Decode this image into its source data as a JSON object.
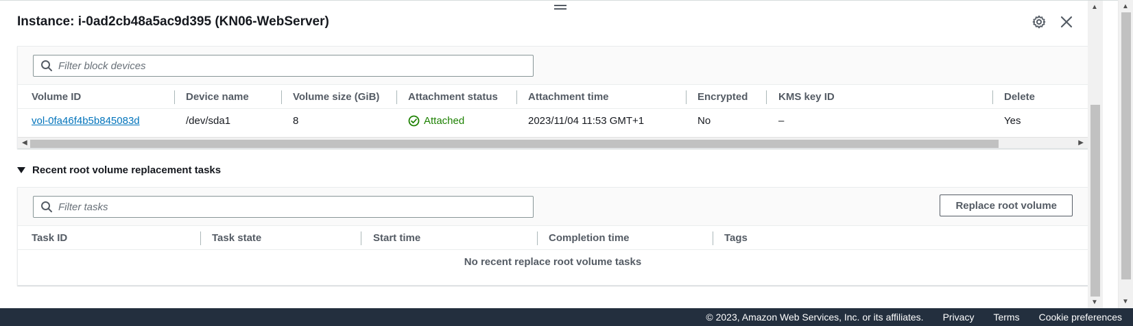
{
  "panel": {
    "title": "Instance: i-0ad2cb48a5ac9d395 (KN06-WebServer)",
    "icons": [
      "gear-icon",
      "close-icon"
    ]
  },
  "block_devices": {
    "filter_placeholder": "Filter block devices",
    "columns": [
      "Volume ID",
      "Device name",
      "Volume size (GiB)",
      "Attachment status",
      "Attachment time",
      "Encrypted",
      "KMS key ID",
      "Delete"
    ],
    "rows": [
      {
        "volume_id": "vol-0fa46f4b5b845083d",
        "device_name": "/dev/sda1",
        "volume_size": "8",
        "attachment_status": "Attached",
        "attachment_time": "2023/11/04 11:53 GMT+1",
        "encrypted": "No",
        "kms_key_id": "–",
        "delete": "Yes"
      }
    ]
  },
  "replacement_tasks": {
    "section_title": "Recent root volume replacement tasks",
    "filter_placeholder": "Filter tasks",
    "replace_button": "Replace root volume",
    "columns": [
      "Task ID",
      "Task state",
      "Start time",
      "Completion time",
      "Tags"
    ],
    "empty_message": "No recent replace root volume tasks"
  },
  "footer": {
    "copyright": "© 2023, Amazon Web Services, Inc. or its affiliates.",
    "links": [
      "Privacy",
      "Terms",
      "Cookie preferences"
    ]
  },
  "colors": {
    "link": "#0073bb",
    "success": "#1d8102",
    "footer_bg": "#232f3e"
  }
}
